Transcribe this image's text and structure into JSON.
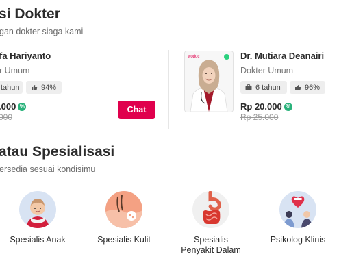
{
  "section1": {
    "title": "si Dokter",
    "subtitle": "gan dokter siaga kami"
  },
  "doctors": [
    {
      "name": "fa Hariyanto",
      "specialty": "r Umum",
      "experience": "tahun",
      "rating": "94%",
      "price": ".000",
      "old_price": "000",
      "chat_label": "Chat"
    },
    {
      "name": "Dr. Mutiara Deanairi",
      "specialty": "Dokter Umum",
      "experience": "6 tahun",
      "rating": "96%",
      "price": "Rp 20.000",
      "old_price": "Rp 25.000",
      "photo_brand": "wodoc",
      "online": true
    }
  ],
  "section2": {
    "title": "atau Spesialisasi",
    "subtitle": "ersedia sesuai kondisimu"
  },
  "categories": [
    {
      "label": "Spesialis Anak",
      "icon": "child-doctor-icon"
    },
    {
      "label": "Spesialis Kulit",
      "icon": "skin-icon"
    },
    {
      "label": "Spesialis Penyakit Dalam",
      "icon": "digestive-organ-icon"
    },
    {
      "label": "Psikolog Klinis",
      "icon": "psychologist-icon"
    }
  ],
  "colors": {
    "accent": "#e0004d",
    "discount_badge": "#2ab27b",
    "online_dot": "#2bd17e",
    "icon_bg": "#d8e3f3"
  },
  "discount_symbol": "%"
}
